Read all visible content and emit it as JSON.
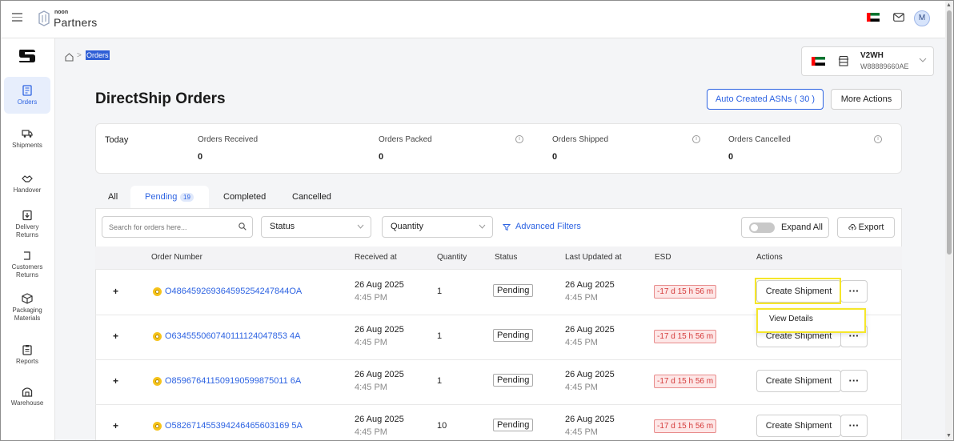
{
  "app": {
    "brand_small": "noon",
    "brand": "Partners",
    "user_initial": "M"
  },
  "sidebar": {
    "items": [
      {
        "label": "Orders",
        "icon": "orders-icon"
      },
      {
        "label": "Shipments",
        "icon": "truck-icon"
      },
      {
        "label": "Handover",
        "icon": "handshake-icon"
      },
      {
        "label": "Delivery Returns",
        "icon": "return-box-icon"
      },
      {
        "label": "Customers Returns",
        "icon": "return-arrow-icon"
      },
      {
        "label": "Packaging Materials",
        "icon": "package-icon"
      },
      {
        "label": "Reports",
        "icon": "clipboard-icon"
      },
      {
        "label": "Warehouse",
        "icon": "warehouse-icon"
      }
    ]
  },
  "breadcrumb": {
    "separator": ">",
    "current": "Orders"
  },
  "store": {
    "code": "V2WH",
    "id": "W88889660AE"
  },
  "page": {
    "title": "DirectShip Orders",
    "auto_asn_label": "Auto Created ASNs ( 30 )",
    "more_actions_label": "More Actions"
  },
  "stats": {
    "today_label": "Today",
    "items": [
      {
        "label": "Orders Received",
        "value": "0"
      },
      {
        "label": "Orders Packed",
        "value": "0"
      },
      {
        "label": "Orders Shipped",
        "value": "0"
      },
      {
        "label": "Orders Cancelled",
        "value": "0"
      }
    ]
  },
  "tabs": {
    "all": "All",
    "pending": "Pending",
    "pending_count": "19",
    "completed": "Completed",
    "cancelled": "Cancelled"
  },
  "filters": {
    "search_placeholder": "Search for orders here...",
    "status": "Status",
    "quantity": "Quantity",
    "advanced": "Advanced Filters",
    "expand_all": "Expand All",
    "export": "Export"
  },
  "table": {
    "headers": {
      "order_number": "Order Number",
      "received_at": "Received at",
      "quantity": "Quantity",
      "status": "Status",
      "last_updated": "Last Updated at",
      "esd": "ESD",
      "actions": "Actions"
    },
    "expand_symbol": "+",
    "create_label": "Create Shipment",
    "dots_label": "···",
    "rows": [
      {
        "order": "O486459269364595254247844OA",
        "date": "26 Aug 2025",
        "time": "4:45 PM",
        "qty": "1",
        "status": "Pending",
        "upd_date": "26 Aug 2025",
        "upd_time": "4:45 PM",
        "esd": "-17 d 15 h 56 m"
      },
      {
        "order": "O634555060740111124047853 4A",
        "date": "26 Aug 2025",
        "time": "4:45 PM",
        "qty": "1",
        "status": "Pending",
        "upd_date": "26 Aug 2025",
        "upd_time": "4:45 PM",
        "esd": "-17 d 15 h 56 m"
      },
      {
        "order": "O859676411509190599875011 6A",
        "date": "26 Aug 2025",
        "time": "4:45 PM",
        "qty": "1",
        "status": "Pending",
        "upd_date": "26 Aug 2025",
        "upd_time": "4:45 PM",
        "esd": "-17 d 15 h 56 m"
      },
      {
        "order": "O582671455394246465603169 5A",
        "date": "26 Aug 2025",
        "time": "4:45 PM",
        "qty": "10",
        "status": "Pending",
        "upd_date": "26 Aug 2025",
        "upd_time": "4:45 PM",
        "esd": "-17 d 15 h 56 m"
      }
    ]
  },
  "menu": {
    "view_details": "View Details"
  },
  "colors": {
    "accent": "#2d63e2",
    "highlight": "#f5e62a",
    "esd_red": "#d53a3a"
  }
}
